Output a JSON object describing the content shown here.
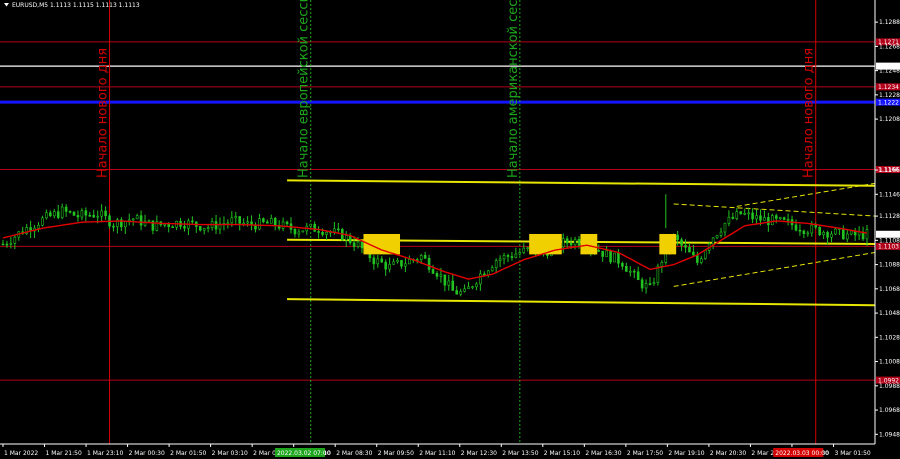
{
  "chart_data": {
    "type": "candlestick",
    "symbol_header": "EURUSD,M5  1.1113 1.1115 1.1113 1.1113",
    "background": "#000000",
    "grid": false,
    "ylim": [
      1.094,
      1.1298
    ],
    "y_ticks": [
      "1.1288",
      "1.1268",
      "1.1248",
      "1.1228",
      "1.1208",
      "1.1166",
      "1.1146",
      "1.1128",
      "1.1108",
      "1.1088",
      "1.1068",
      "1.1048",
      "1.1028",
      "1.1008",
      "1.0988",
      "1.0968",
      "1.0948"
    ],
    "x_ticks": [
      "1 Mar 2022",
      "1 Mar 21:50",
      "1 Mar 23:10",
      "2 Mar 00:30",
      "2 Mar 01:50",
      "2 Mar 03:10",
      "2 Mar 04:30",
      "2 Mar 07:10",
      "2 Mar 08:30",
      "2 Mar 09:50",
      "2 Mar 11:10",
      "2 Mar 12:30",
      "2 Mar 13:50",
      "2 Mar 15:10",
      "2 Mar 16:30",
      "2 Mar 17:50",
      "2 Mar 19:10",
      "2 Mar 20:30",
      "2 Mar 21:50",
      "2 Mar 00:30",
      "3 Mar 01:50"
    ],
    "x_highlight_labels": [
      {
        "text": "2022.03.02 07:00",
        "color": "#1ea51e",
        "after_index": 6
      },
      {
        "text": "2022.03.03 00:00",
        "color": "#d40000",
        "after_index": 18
      }
    ],
    "x_count": 220,
    "close_series": [
      [
        0,
        1.1105
      ],
      [
        6,
        1.1118
      ],
      [
        10,
        1.1125
      ],
      [
        15,
        1.1132
      ],
      [
        19,
        1.1128
      ],
      [
        24,
        1.113
      ],
      [
        28,
        1.1122
      ],
      [
        33,
        1.1126
      ],
      [
        38,
        1.112
      ],
      [
        45,
        1.1123
      ],
      [
        52,
        1.1119
      ],
      [
        58,
        1.1124
      ],
      [
        62,
        1.1121
      ],
      [
        68,
        1.1122
      ],
      [
        74,
        1.1117
      ],
      [
        80,
        1.1118
      ],
      [
        86,
        1.1112
      ],
      [
        90,
        1.1104
      ],
      [
        94,
        1.1092
      ],
      [
        98,
        1.1086
      ],
      [
        102,
        1.109
      ],
      [
        106,
        1.1095
      ],
      [
        110,
        1.1082
      ],
      [
        114,
        1.1066
      ],
      [
        117,
        1.1064
      ],
      [
        121,
        1.108
      ],
      [
        125,
        1.1092
      ],
      [
        129,
        1.1096
      ],
      [
        133,
        1.11
      ],
      [
        137,
        1.1098
      ],
      [
        141,
        1.1105
      ],
      [
        145,
        1.1108
      ],
      [
        149,
        1.1104
      ],
      [
        153,
        1.1096
      ],
      [
        157,
        1.109
      ],
      [
        161,
        1.1074
      ],
      [
        164,
        1.1068
      ],
      [
        167,
        1.1092
      ],
      [
        170,
        1.111
      ],
      [
        173,
        1.11
      ],
      [
        176,
        1.109
      ],
      [
        179,
        1.1108
      ],
      [
        183,
        1.1122
      ],
      [
        187,
        1.113
      ],
      [
        191,
        1.1126
      ],
      [
        195,
        1.1124
      ],
      [
        199,
        1.1122
      ],
      [
        203,
        1.1118
      ],
      [
        207,
        1.1116
      ],
      [
        211,
        1.1114
      ],
      [
        215,
        1.1112
      ],
      [
        219,
        1.1113
      ]
    ],
    "ma_series": [
      [
        0,
        1.111
      ],
      [
        10,
        1.1118
      ],
      [
        20,
        1.1123
      ],
      [
        30,
        1.1124
      ],
      [
        40,
        1.1122
      ],
      [
        50,
        1.1121
      ],
      [
        60,
        1.1121
      ],
      [
        70,
        1.112
      ],
      [
        80,
        1.1117
      ],
      [
        88,
        1.1112
      ],
      [
        96,
        1.11
      ],
      [
        104,
        1.1092
      ],
      [
        112,
        1.1082
      ],
      [
        118,
        1.1076
      ],
      [
        124,
        1.108
      ],
      [
        132,
        1.1092
      ],
      [
        140,
        1.11
      ],
      [
        148,
        1.1104
      ],
      [
        156,
        1.1098
      ],
      [
        164,
        1.1084
      ],
      [
        170,
        1.1088
      ],
      [
        176,
        1.1096
      ],
      [
        182,
        1.1108
      ],
      [
        188,
        1.112
      ],
      [
        196,
        1.1124
      ],
      [
        204,
        1.1122
      ],
      [
        212,
        1.1118
      ],
      [
        219,
        1.1114
      ]
    ],
    "horizontal_levels": [
      {
        "price": 1.12717,
        "color": "#b3001a",
        "label": "1.1271"
      },
      {
        "price": 1.12517,
        "color": "#ffffff",
        "label": "1.1251"
      },
      {
        "price": 1.12346,
        "color": "#b3001a",
        "label": "1.1234"
      },
      {
        "price": 1.1222,
        "color": "#1414ff",
        "label": "1.1222"
      },
      {
        "price": 1.11664,
        "color": "#b3001a",
        "label": "1.1166"
      },
      {
        "price": 1.1103,
        "color": "#b3001a",
        "label": "1.1103"
      },
      {
        "price": 1.09927,
        "color": "#b3001a",
        "label": "1.0992"
      }
    ],
    "price_marker": {
      "price": 1.1113,
      "label": "1.1113"
    },
    "vertical_lines": [
      {
        "x_index": 27,
        "color": "#d20000",
        "text": "Начало нового дня"
      },
      {
        "x_index": 78,
        "color": "#1ea51e",
        "text": "Начало европейской сессии"
      },
      {
        "x_index": 131,
        "color": "#1ea51e",
        "text": "Начало американской сессии"
      },
      {
        "x_index": 206,
        "color": "#d20000",
        "text": "Начало нового дня"
      }
    ],
    "trend_channels": [
      {
        "color": "#e6e600",
        "y_start": 1.11575,
        "y_end": 1.1153
      },
      {
        "color": "#e6e600",
        "y_start": 1.11085,
        "y_end": 1.1105
      },
      {
        "color": "#e6e600",
        "y_start": 1.10595,
        "y_end": 1.10545
      }
    ],
    "signal_boxes": [
      92,
      100,
      134,
      141,
      147,
      150,
      167,
      170
    ]
  }
}
